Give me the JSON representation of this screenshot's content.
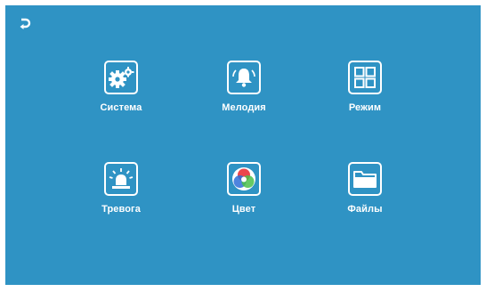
{
  "header": {
    "back_icon": "back-arrow-icon"
  },
  "menu": {
    "items": [
      {
        "label": "Система",
        "icon": "gears-icon"
      },
      {
        "label": "Мелодия",
        "icon": "bell-icon"
      },
      {
        "label": "Режим",
        "icon": "grid-icon"
      },
      {
        "label": "Тревога",
        "icon": "alarm-siren-icon"
      },
      {
        "label": "Цвет",
        "icon": "color-circles-icon"
      },
      {
        "label": "Файлы",
        "icon": "folder-icon"
      }
    ]
  },
  "colors": {
    "background": "#2f93c4",
    "foreground": "#ffffff",
    "color_red": "#e8333a",
    "color_green": "#4bbf4a",
    "color_blue": "#2f6fd8"
  }
}
